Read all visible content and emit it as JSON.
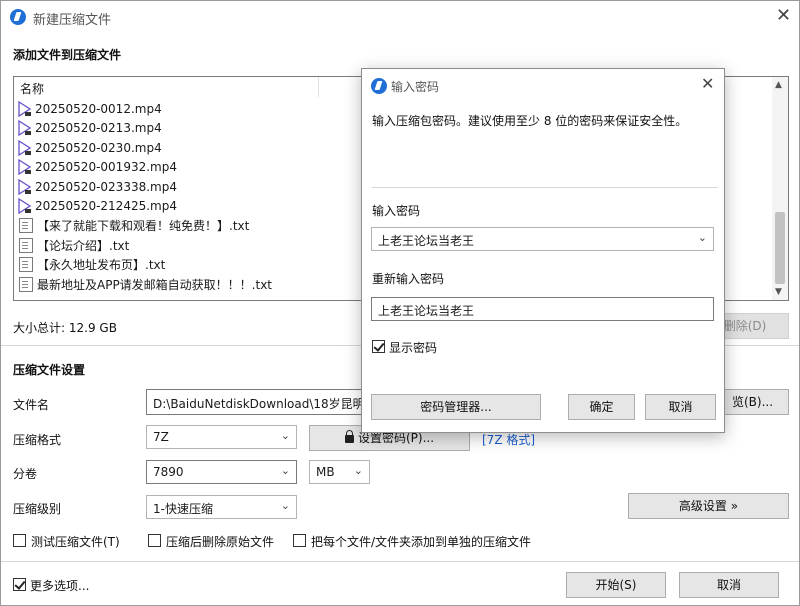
{
  "window": {
    "title": "新建压缩文件",
    "section_add": "添加文件到压缩文件",
    "list_header": "名称",
    "files": [
      {
        "name": "20250520-0012.mp4",
        "type": "video"
      },
      {
        "name": "20250520-0213.mp4",
        "type": "video"
      },
      {
        "name": "20250520-0230.mp4",
        "type": "video"
      },
      {
        "name": "20250520-001932.mp4",
        "type": "video"
      },
      {
        "name": "20250520-023338.mp4",
        "type": "video"
      },
      {
        "name": "20250520-212425.mp4",
        "type": "video"
      },
      {
        "name": "【来了就能下载和观看！纯免费！】.txt",
        "type": "text"
      },
      {
        "name": "【论坛介绍】.txt",
        "type": "text"
      },
      {
        "name": "【永久地址发布页】.txt",
        "type": "text"
      },
      {
        "name": "最新地址及APP请发邮箱自动获取！！！.txt",
        "type": "text"
      }
    ],
    "total_size": "大小总计: 12.9 GB",
    "delete_button": "删除(D)",
    "section_settings": "压缩文件设置",
    "filename_label": "文件名",
    "filename_value": "D:\\BaiduNetdiskDownload\\18岁昆明",
    "browse_button": "览(B)...",
    "format_label": "压缩格式",
    "format_value": "7Z",
    "set_password_button": "设置密码(P)...",
    "format_tag": "[7Z 格式]",
    "split_label": "分卷",
    "split_value": "7890",
    "split_unit": "MB",
    "level_label": "压缩级别",
    "level_value": "1-快速压缩",
    "advanced_button": "高级设置 »",
    "test_checkbox": "测试压缩文件(T)",
    "delete_after_checkbox": "压缩后删除原始文件",
    "separate_checkbox": "把每个文件/文件夹添加到单独的压缩文件",
    "more_options_checkbox": "更多选项...",
    "start_button": "开始(S)",
    "cancel_button": "取消"
  },
  "dialog": {
    "title": "输入密码",
    "description": "输入压缩包密码。建议使用至少 8 位的密码来保证安全性。",
    "password_label": "输入密码",
    "password_value": "上老王论坛当老王",
    "reenter_label": "重新输入密码",
    "reenter_value": "上老王论坛当老王",
    "show_password": "显示密码",
    "manager_button": "密码管理器...",
    "ok_button": "确定",
    "cancel_button": "取消"
  },
  "colors": {
    "accent": "#1f6fd6",
    "link": "#1a5fd0",
    "video_icon": "#6a4fc9"
  }
}
